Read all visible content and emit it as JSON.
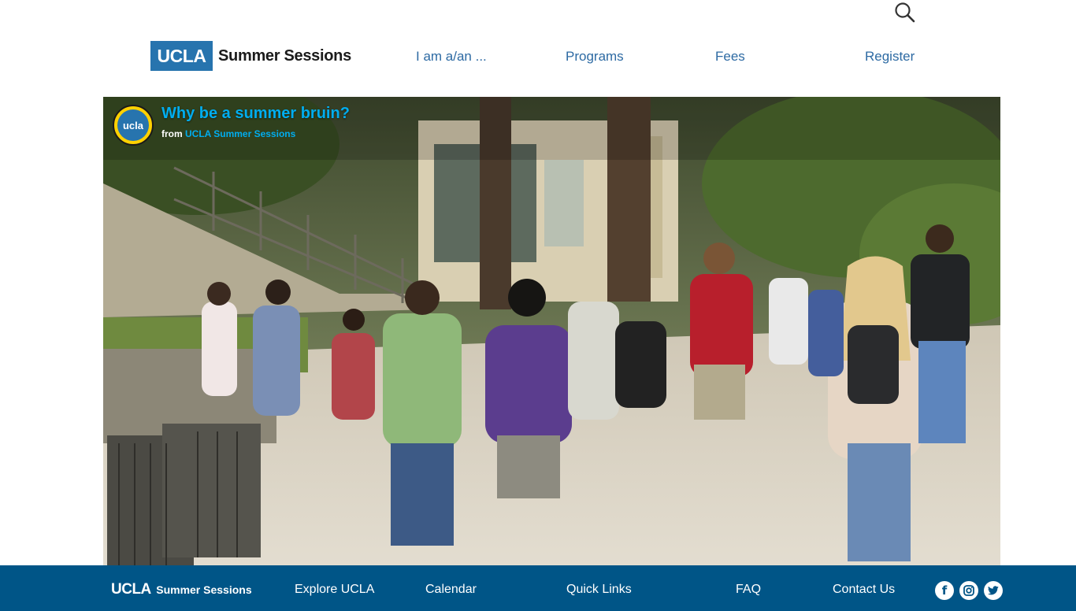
{
  "header": {
    "logo_mark": "UCLA",
    "logo_text": "Summer Sessions",
    "search_icon": "search-icon",
    "nav": [
      {
        "label": "I am a/an ..."
      },
      {
        "label": "Programs"
      },
      {
        "label": "Fees"
      },
      {
        "label": "Register"
      }
    ]
  },
  "video": {
    "title": "Why be a summer bruin?",
    "byline_prefix": "from",
    "byline_channel": "UCLA Summer Sessions",
    "channel_avatar_text": "ucla"
  },
  "footer": {
    "logo_mark": "UCLA",
    "logo_text": "Summer Sessions",
    "links": [
      {
        "label": "Explore UCLA"
      },
      {
        "label": "Calendar"
      },
      {
        "label": "Quick Links"
      },
      {
        "label": "FAQ"
      },
      {
        "label": "Contact Us"
      }
    ],
    "social": [
      {
        "icon": "facebook-icon",
        "glyph": "f"
      },
      {
        "icon": "instagram-icon",
        "glyph": ""
      },
      {
        "icon": "twitter-icon",
        "glyph": ""
      }
    ]
  },
  "colors": {
    "ucla_blue": "#2774ae",
    "footer_blue": "#005587",
    "nav_link": "#2d6aa3",
    "video_title": "#00adef"
  }
}
